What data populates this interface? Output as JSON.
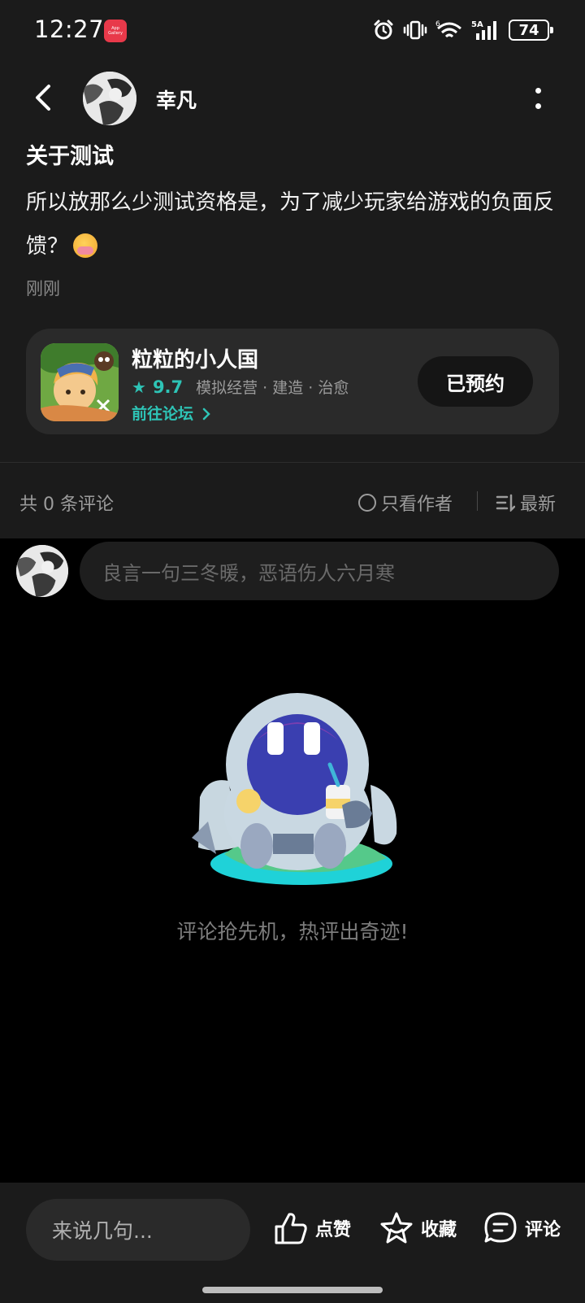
{
  "status_bar": {
    "time": "12:27",
    "app_icon_label": "App Gallery",
    "network_label": "5A",
    "wifi_label": "6",
    "battery": "74"
  },
  "header": {
    "username": "幸凡"
  },
  "post": {
    "title": "关于测试",
    "body": "所以放那么少测试资格是，为了减少玩家给游戏的负面反馈？",
    "time": "刚刚"
  },
  "game_card": {
    "name": "粒粒的小人国",
    "rating": "9.7",
    "tags": "模拟经营 · 建造 · 治愈",
    "forum_link": "前往论坛",
    "reserve_label": "已预约"
  },
  "comments_bar": {
    "count_text": "共 0 条评论",
    "author_only": "只看作者",
    "sort_label": "最新"
  },
  "comment_input": {
    "placeholder": "良言一句三冬暖，恶语伤人六月寒"
  },
  "empty_state": {
    "text": "评论抢先机，热评出奇迹!"
  },
  "bottom_bar": {
    "input_placeholder": "来说几句...",
    "like_label": "点赞",
    "favorite_label": "收藏",
    "comment_label": "评论"
  },
  "colors": {
    "accent": "#2ec4b6",
    "background": "#000000",
    "surface": "#1b1b1b"
  }
}
